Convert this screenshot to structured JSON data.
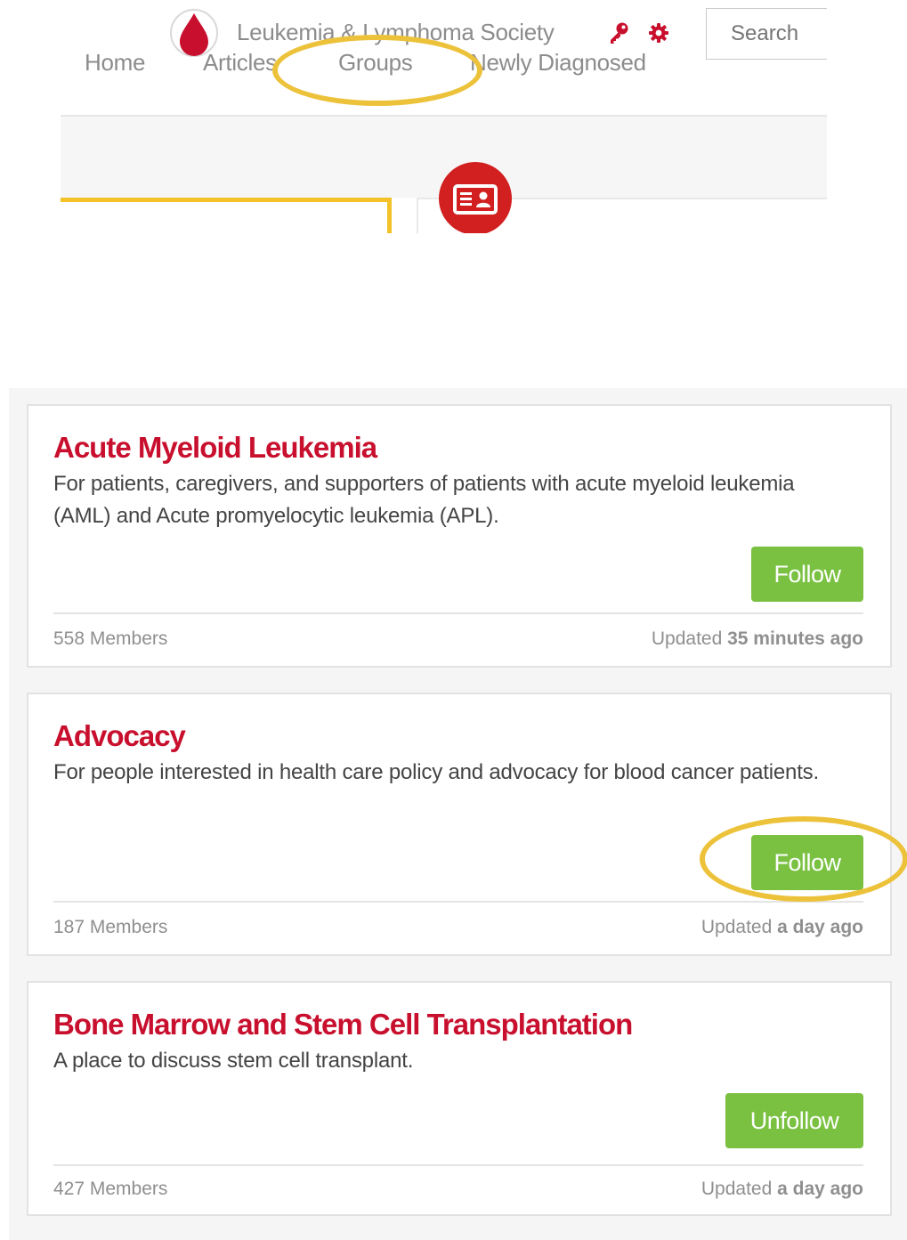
{
  "header": {
    "site_name": "Leukemia & Lymphoma Society",
    "search_placeholder": "Search",
    "nav": {
      "home": "Home",
      "articles": "Articles",
      "groups": "Groups",
      "newly_diagnosed": "Newly Diagnosed"
    },
    "icons": {
      "logo": "blood-drop-logo-icon",
      "account": "key-icon",
      "settings": "gear-icon",
      "groups_badge": "id-card-icon"
    }
  },
  "colors": {
    "brand_red": "#c8102e",
    "follow_green": "#7ac142",
    "annotation_yellow": "#edc23b"
  },
  "groups": [
    {
      "title": "Acute Myeloid Leukemia",
      "description": "For patients, caregivers, and supporters of patients with acute myeloid leukemia (AML) and Acute promyelocytic leukemia (APL).",
      "button": "Follow",
      "members": "558 Members",
      "updated_prefix": "Updated",
      "updated_time": "35 minutes ago"
    },
    {
      "title": "Advocacy",
      "description": "For people interested in health care policy and advocacy for blood cancer patients.",
      "button": "Follow",
      "members": "187 Members",
      "updated_prefix": "Updated",
      "updated_time": "a day ago"
    },
    {
      "title": "Bone Marrow and Stem Cell Transplantation",
      "description": "A place to discuss stem cell transplant.",
      "button": "Unfollow",
      "members": "427 Members",
      "updated_prefix": "Updated",
      "updated_time": "a day ago"
    }
  ]
}
